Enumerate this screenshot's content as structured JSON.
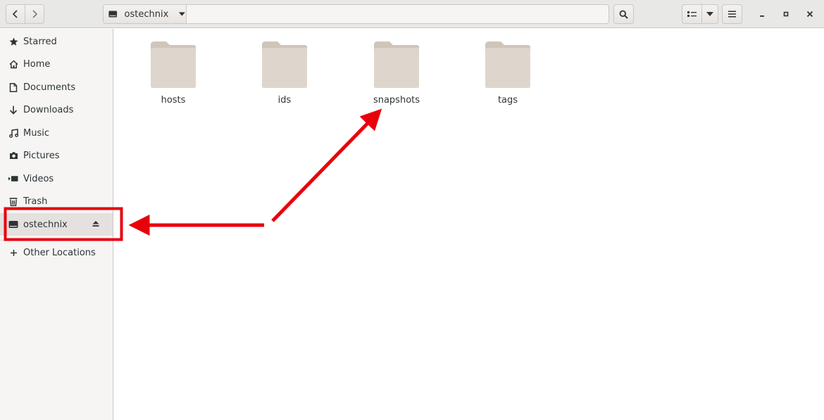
{
  "header": {
    "location": "ostechnix"
  },
  "sidebar": {
    "items": [
      {
        "label": "Starred",
        "icon": "star-icon"
      },
      {
        "label": "Home",
        "icon": "home-icon"
      },
      {
        "label": "Documents",
        "icon": "document-icon"
      },
      {
        "label": "Downloads",
        "icon": "download-icon"
      },
      {
        "label": "Music",
        "icon": "music-icon"
      },
      {
        "label": "Pictures",
        "icon": "camera-icon"
      },
      {
        "label": "Videos",
        "icon": "video-icon"
      },
      {
        "label": "Trash",
        "icon": "trash-icon"
      },
      {
        "label": "ostechnix",
        "icon": "drive-icon",
        "active": true
      },
      {
        "label": "Other Locations",
        "icon": "plus-icon"
      }
    ]
  },
  "files": [
    {
      "name": "hosts"
    },
    {
      "name": "ids"
    },
    {
      "name": "snapshots"
    },
    {
      "name": "tags"
    }
  ],
  "colors": {
    "folder": "#ded6cd",
    "folder_tab": "#cfc5bb",
    "annotation": "#e8000b"
  }
}
